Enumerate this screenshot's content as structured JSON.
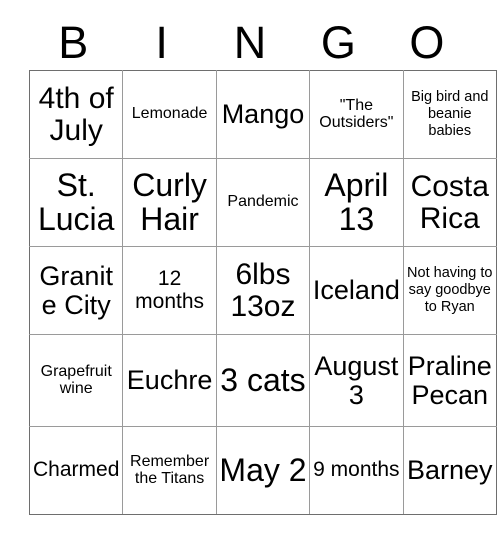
{
  "card": {
    "title": "BINGO",
    "header_letters": [
      "B",
      "I",
      "N",
      "G",
      "O"
    ],
    "border_color": "#9a9a9a",
    "outer_border_color": "#6e6e6e",
    "text_color": "#000000",
    "background_color": "#ffffff",
    "columns": 5,
    "rows": 5,
    "squares": [
      [
        {
          "text": "4th of July",
          "size": "lg"
        },
        {
          "text": "Lemonade",
          "size": "xs"
        },
        {
          "text": "Mango",
          "size": "md"
        },
        {
          "text": "\"The Outsiders\"",
          "size": "xs"
        },
        {
          "text": "Big bird and beanie babies",
          "size": "xxs"
        }
      ],
      [
        {
          "text": "St. Lucia",
          "size": "xl"
        },
        {
          "text": "Curly Hair",
          "size": "xl"
        },
        {
          "text": "Pandemic",
          "size": "xs"
        },
        {
          "text": "April 13",
          "size": "xl"
        },
        {
          "text": "Costa Rica",
          "size": "lg"
        }
      ],
      [
        {
          "text": "Granite City",
          "size": "md"
        },
        {
          "text": "12 months",
          "size": "sm"
        },
        {
          "text": "6lbs 13oz",
          "size": "lg"
        },
        {
          "text": "Iceland",
          "size": "md"
        },
        {
          "text": "Not having to say goodbye to Ryan",
          "size": "xxs"
        }
      ],
      [
        {
          "text": "Grapefruit wine",
          "size": "xs"
        },
        {
          "text": "Euchre",
          "size": "md"
        },
        {
          "text": "3 cats",
          "size": "xl"
        },
        {
          "text": "August 3",
          "size": "md"
        },
        {
          "text": "Praline Pecan",
          "size": "md"
        }
      ],
      [
        {
          "text": "Charmed",
          "size": "sm"
        },
        {
          "text": "Remember the Titans",
          "size": "xs"
        },
        {
          "text": "May 2",
          "size": "xl"
        },
        {
          "text": "9 months",
          "size": "sm"
        },
        {
          "text": "Barney",
          "size": "md"
        }
      ]
    ]
  }
}
